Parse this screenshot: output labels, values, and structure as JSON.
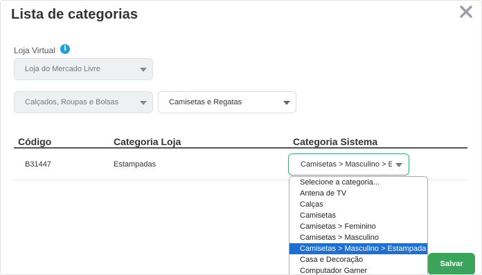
{
  "modal": {
    "title": "Lista de categorias",
    "close_icon": "close-icon"
  },
  "filters": {
    "store_label": "Loja Virtual",
    "info_icon_glyph": "i",
    "store_value": "Loja do Mercado Livre",
    "parent_category_value": "Calçados, Roupas e Bolsas",
    "sub_category_value": "Camisetas e Regatas"
  },
  "table": {
    "headers": [
      "Código",
      "Categoria Loja",
      "Categoria Sistema"
    ],
    "rows": [
      {
        "code": "B31447",
        "store_category": "Estampadas",
        "system_category": "Camisetas > Masculino > Estampada"
      }
    ]
  },
  "dropdown": {
    "options": [
      "Selecione a categoria...",
      "Antena de TV",
      "Calças",
      "Camisetas",
      "Camisetas > Feminino",
      "Camisetas > Masculino",
      "Camisetas > Masculino > Estampada",
      "Casa e Decoração",
      "Computador Gamer"
    ],
    "selected_index": 6
  },
  "actions": {
    "save_label": "Salvar"
  },
  "colors": {
    "accent_green": "#3aa55a",
    "selection_blue": "#1e6fd0",
    "info_blue": "#1d9fe0"
  }
}
